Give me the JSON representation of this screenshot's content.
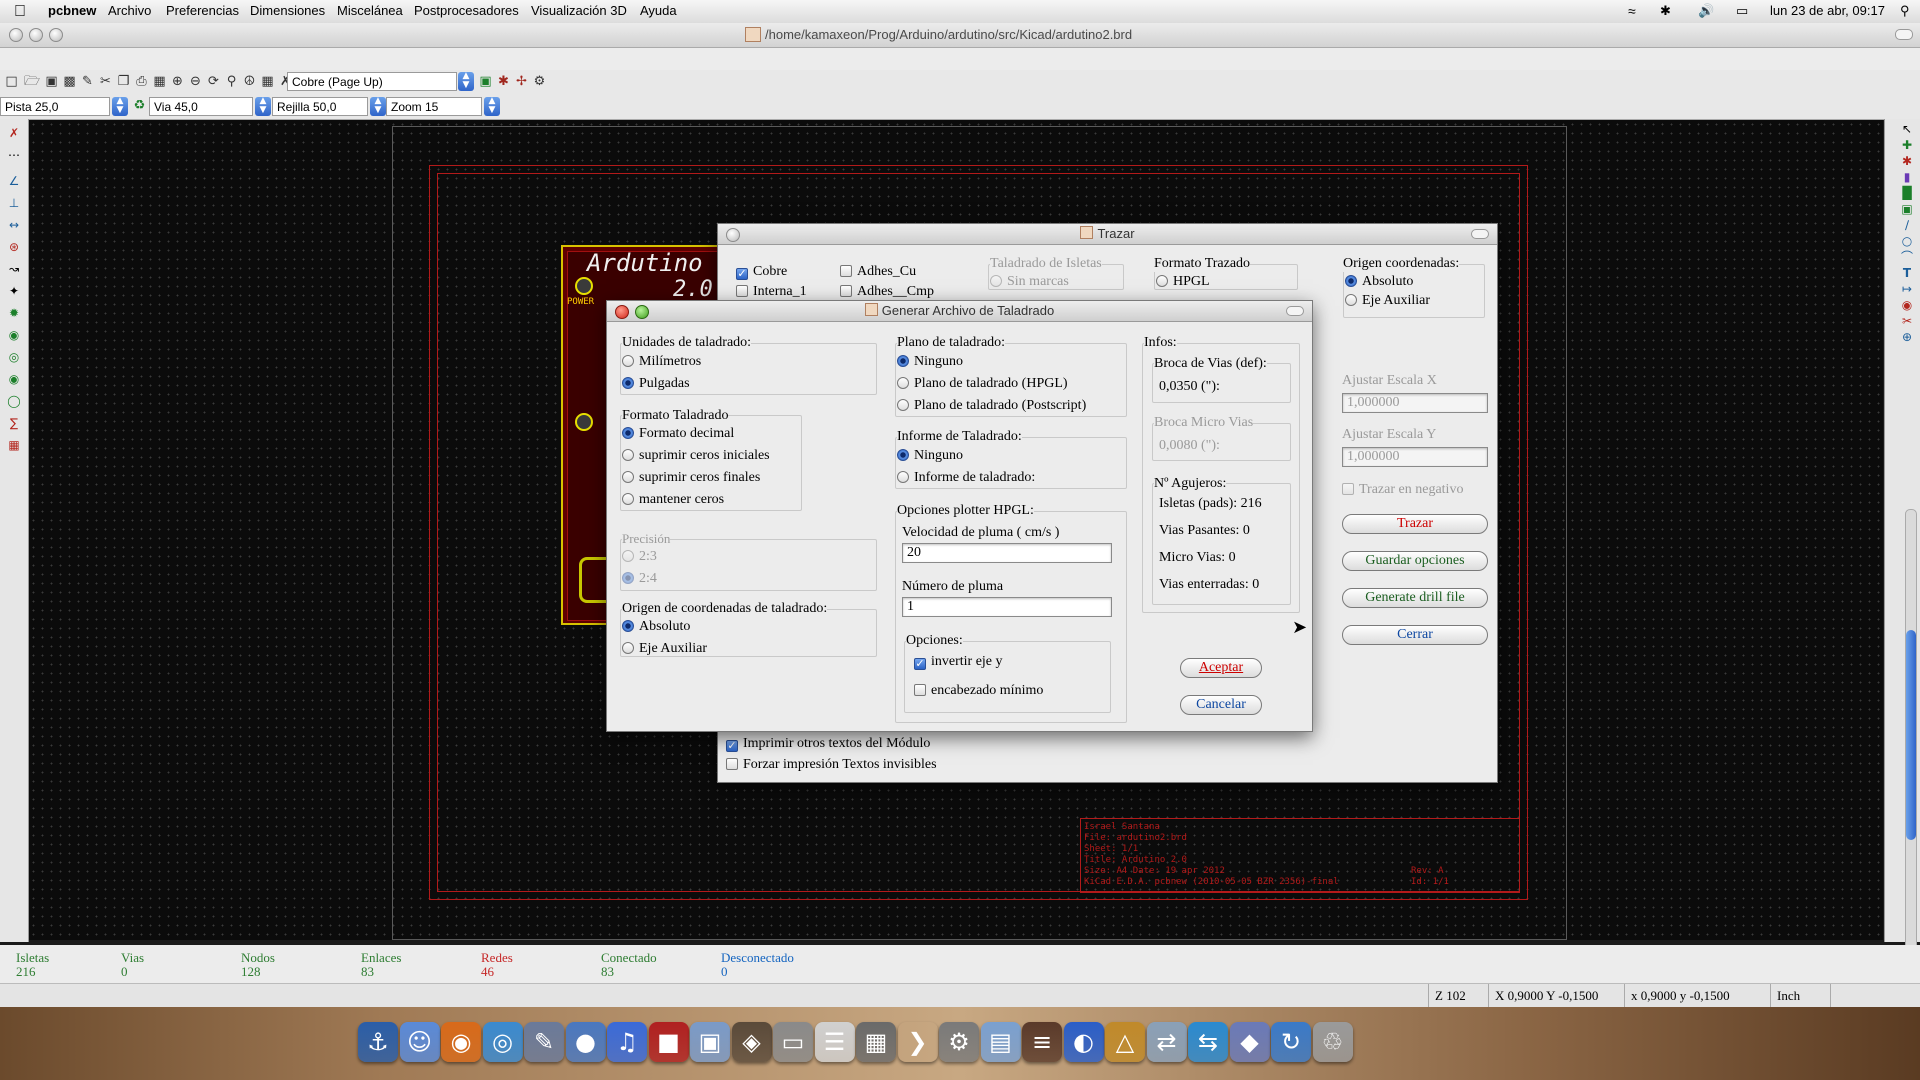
{
  "menubar": {
    "app": "pcbnew",
    "items": [
      "Archivo",
      "Preferencias",
      "Dimensiones",
      "Miscelánea",
      "Postprocesadores",
      "Visualización 3D",
      "Ayuda"
    ],
    "clock": "lun 23 de abr, 09:17"
  },
  "window": {
    "title": "/home/kamaxeon/Prog/Arduino/ardutino/src/Kicad/ardutino2.brd"
  },
  "toolbar": {
    "layer_combo": "Cobre (Page Up)",
    "track_combo": "Pista 25,0",
    "via_combo": "Via 45,0",
    "grid_combo": "Rejilla 50,0",
    "zoom_combo": "Zoom 15"
  },
  "board": {
    "silk_title": "Ardutino",
    "silk_version": "2.0",
    "power_label": "POWER",
    "titleblock_lines": [
      "Israel Santana",
      "File: ardutino2.brd",
      "Sheet: 1/1",
      "Title: Ardutino 2.0",
      "Size: A4   Date: 19 apr 2012",
      "KiCad E.D.A. pcbnew (2010-05-05 BZR 2356)-final"
    ],
    "titleblock_rev": "Rev: A",
    "titleblock_id": "Id: 1/1"
  },
  "trazar": {
    "title": "Trazar",
    "layers": {
      "cobre": "Cobre",
      "interna1": "Interna_1",
      "adhes_cu": "Adhes_Cu",
      "adhes_cmp": "Adhes__Cmp"
    },
    "taladrado_title": "Taladrado de Isletas",
    "sin_marcas": "Sin marcas",
    "formato_title": "Formato Trazado",
    "hpgl": "HPGL",
    "origen_title": "Origen coordenadas:",
    "absoluto": "Absoluto",
    "eje_aux": "Eje Auxiliar",
    "escala_x_label": "Ajustar Escala X",
    "escala_x": "1,000000",
    "escala_y_label": "Ajustar Escala Y",
    "escala_y": "1,000000",
    "negativo": "Trazar en negativo",
    "btn_trazar": "Trazar",
    "btn_guardar": "Guardar opciones",
    "btn_drill": "Generate drill file",
    "btn_cerrar": "Cerrar",
    "imprimir_textos": "Imprimir otros textos del Módulo",
    "forzar": "Forzar impresión Textos invisibles"
  },
  "drill": {
    "title": "Generar Archivo de Taladrado",
    "unidades_title": "Unidades de taladrado:",
    "milimetros": "Milímetros",
    "pulgadas": "Pulgadas",
    "formato_title": "Formato Taladrado",
    "formato_decimal": "Formato decimal",
    "suprimir_iniciales": "suprimir ceros iniciales",
    "suprimir_finales": "suprimir ceros finales",
    "mantener": "mantener ceros",
    "precision_title": "Precisión",
    "p23": "2:3",
    "p24": "2:4",
    "origen_title": "Origen de coordenadas de taladrado:",
    "absoluto": "Absoluto",
    "eje_aux": "Eje Auxiliar",
    "plano_title": "Plano de taladrado:",
    "plano_ninguno": "Ninguno",
    "plano_hpgl": "Plano de taladrado (HPGL)",
    "plano_ps": "Plano de taladrado (Postscript)",
    "informe_title": "Informe de Taladrado:",
    "informe_ninguno": "Ninguno",
    "informe_si": "Informe de taladrado:",
    "hpgl_title": "Opciones plotter HPGL:",
    "velocidad_label": "Velocidad de pluma ( cm/s )",
    "velocidad": "20",
    "numero_label": "Número de pluma",
    "numero": "1",
    "opciones_title": "Opciones:",
    "invertir": "invertir eje y",
    "encabezado": "encabezado mínimo",
    "infos_title": "Infos:",
    "broca_vias_title": "Broca de Vias (def):",
    "broca_vias": "0,0350 (\"):",
    "broca_micro_title": "Broca Micro Vias",
    "broca_micro": "0,0080 (\"):",
    "agujeros_title": "Nº Agujeros:",
    "isletas": "Isletas (pads): 216",
    "vias_pasantes": "Vias Pasantes: 0",
    "micro_vias": "Micro Vias: 0",
    "vias_enterradas": "Vias enterradas: 0",
    "aceptar": "Aceptar",
    "cancelar": "Cancelar"
  },
  "stats": [
    {
      "label": "Isletas",
      "value": "216",
      "color": "#2e7d32"
    },
    {
      "label": "Vias",
      "value": "0",
      "color": "#2e7d32"
    },
    {
      "label": "Nodos",
      "value": "128",
      "color": "#2e7d32"
    },
    {
      "label": "Enlaces",
      "value": "83",
      "color": "#2e7d32"
    },
    {
      "label": "Redes",
      "value": "46",
      "color": "#c62828"
    },
    {
      "label": "Conectado",
      "value": "83",
      "color": "#2e7d32"
    },
    {
      "label": "Desconectado",
      "value": "0",
      "color": "#1565c0"
    }
  ],
  "statusbar": {
    "z": "Z 102",
    "abs_xy": "X 0,9000  Y -0,1500",
    "rel_xy": "x 0,9000  y -0,1500",
    "units": "Inch"
  },
  "dock_icons": [
    "anchor-icon",
    "finder-icon",
    "firefox-icon",
    "chrome-icon",
    "preview-icon",
    "network-icon",
    "itunes-icon",
    "photobooth-icon",
    "iphoto-icon",
    "camera-icon",
    "scanner-icon",
    "textedit-icon",
    "calculator-icon",
    "terminal-icon",
    "sysprefs-icon",
    "folder-icon",
    "books-icon",
    "browser-icon",
    "kicad-icon",
    "migration-icon",
    "teamviewer-icon",
    "package-icon",
    "sync-icon",
    "trash-icon"
  ]
}
